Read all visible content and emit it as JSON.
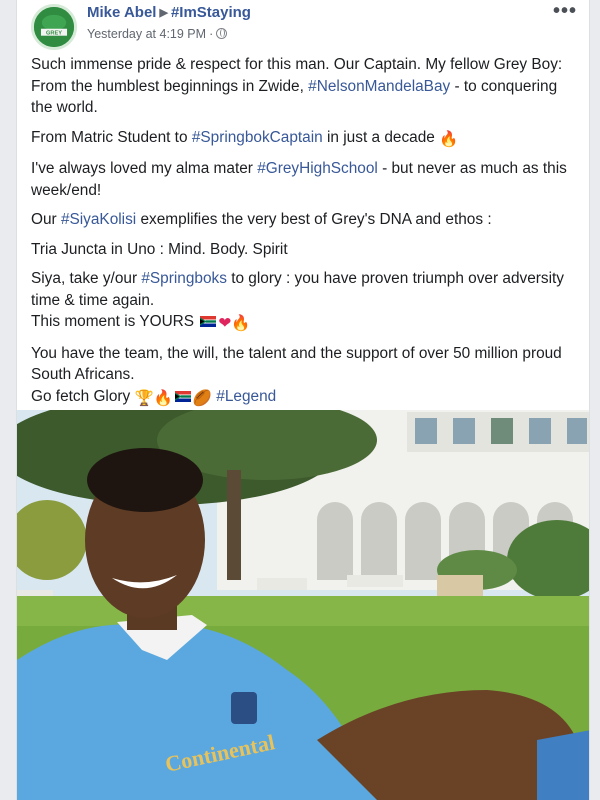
{
  "post": {
    "author": "Mike Abel",
    "shared_to": "#ImStaying",
    "timestamp": "Yesterday at 4:19 PM",
    "privacy_icon": "globe-icon",
    "more_icon": "more-options-icon",
    "avatar_text": "GREY",
    "paragraphs": {
      "p1_a": "Such immense pride & respect for this man. Our Captain. My fellow Grey Boy: From the humblest beginnings in Zwide, ",
      "p1_tag": "#NelsonMandelaBay",
      "p1_b": " - to conquering the world.",
      "p2_a": "From Matric Student to ",
      "p2_tag": "#SpringbokCaptain",
      "p2_b": " in just a decade ",
      "p3_a": "I've always loved my alma mater ",
      "p3_tag": "#GreyHighSchool",
      "p3_b": " - but never as much as this week/end!",
      "p4_a": "Our ",
      "p4_tag": "#SiyaKolisi",
      "p4_b": " exemplifies the very best of Grey's DNA and ethos :",
      "p5": "Tria Juncta in Uno : Mind. Body. Spirit",
      "p6_a": "Siya, take y/our ",
      "p6_tag": "#Springboks",
      "p6_b": " to glory : you have proven triumph over adversity time & time again.",
      "p6_c": "This moment is YOURS ",
      "p7_a": "You have the team, the will, the talent and the support of over 50 million proud South Africans.",
      "p7_b": "Go fetch Glory ",
      "p7_tag": "#Legend"
    },
    "emoji": {
      "fire": "🔥",
      "heart": "❤",
      "trophy": "🏆",
      "rugby": "🏉"
    },
    "photo": {
      "jersey_text": "Continental",
      "colors": {
        "sky": "#cfe3f3",
        "grass": "#6fa33a",
        "jersey": "#5aa8df",
        "building": "#f1f1ee"
      }
    }
  }
}
